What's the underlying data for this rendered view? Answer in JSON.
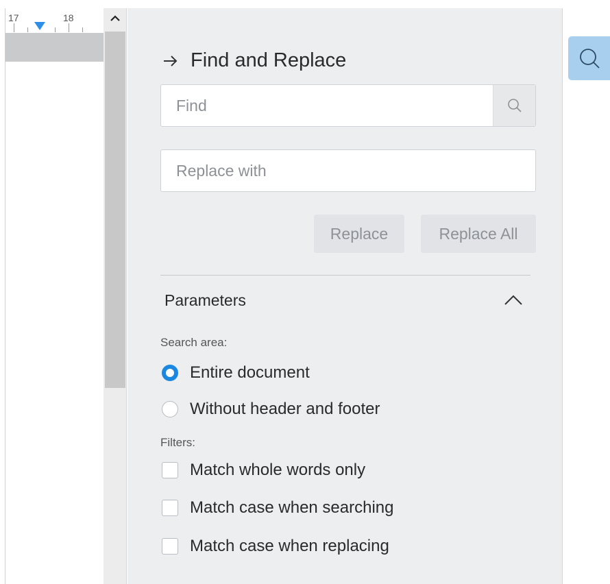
{
  "ruler": {
    "mark_17": "17",
    "mark_18": "18"
  },
  "panel": {
    "title": "Find and Replace",
    "find": {
      "placeholder": "Find",
      "value": ""
    },
    "replace": {
      "placeholder": "Replace with",
      "value": ""
    },
    "buttons": {
      "replace": "Replace",
      "replace_all": "Replace All"
    },
    "parameters": {
      "label": "Parameters",
      "search_area": {
        "label": "Search area:",
        "options": [
          {
            "label": "Entire document",
            "selected": true
          },
          {
            "label": "Without header and footer",
            "selected": false
          }
        ]
      },
      "filters": {
        "label": "Filters:",
        "options": [
          {
            "label": "Match whole words only",
            "checked": false
          },
          {
            "label": "Match case when searching",
            "checked": false
          },
          {
            "label": "Match case when replacing",
            "checked": false
          }
        ]
      }
    }
  },
  "icons": {
    "back": "arrow-right-icon",
    "find_search": "search-icon",
    "collapse": "chevron-up-icon",
    "scroll_up": "chevron-up-icon",
    "side_search": "search-icon"
  },
  "colors": {
    "accent": "#1a87e0",
    "side_button": "#a8cfee",
    "ruler_marker": "#2f8ee6",
    "panel_bg": "#eceef0"
  }
}
